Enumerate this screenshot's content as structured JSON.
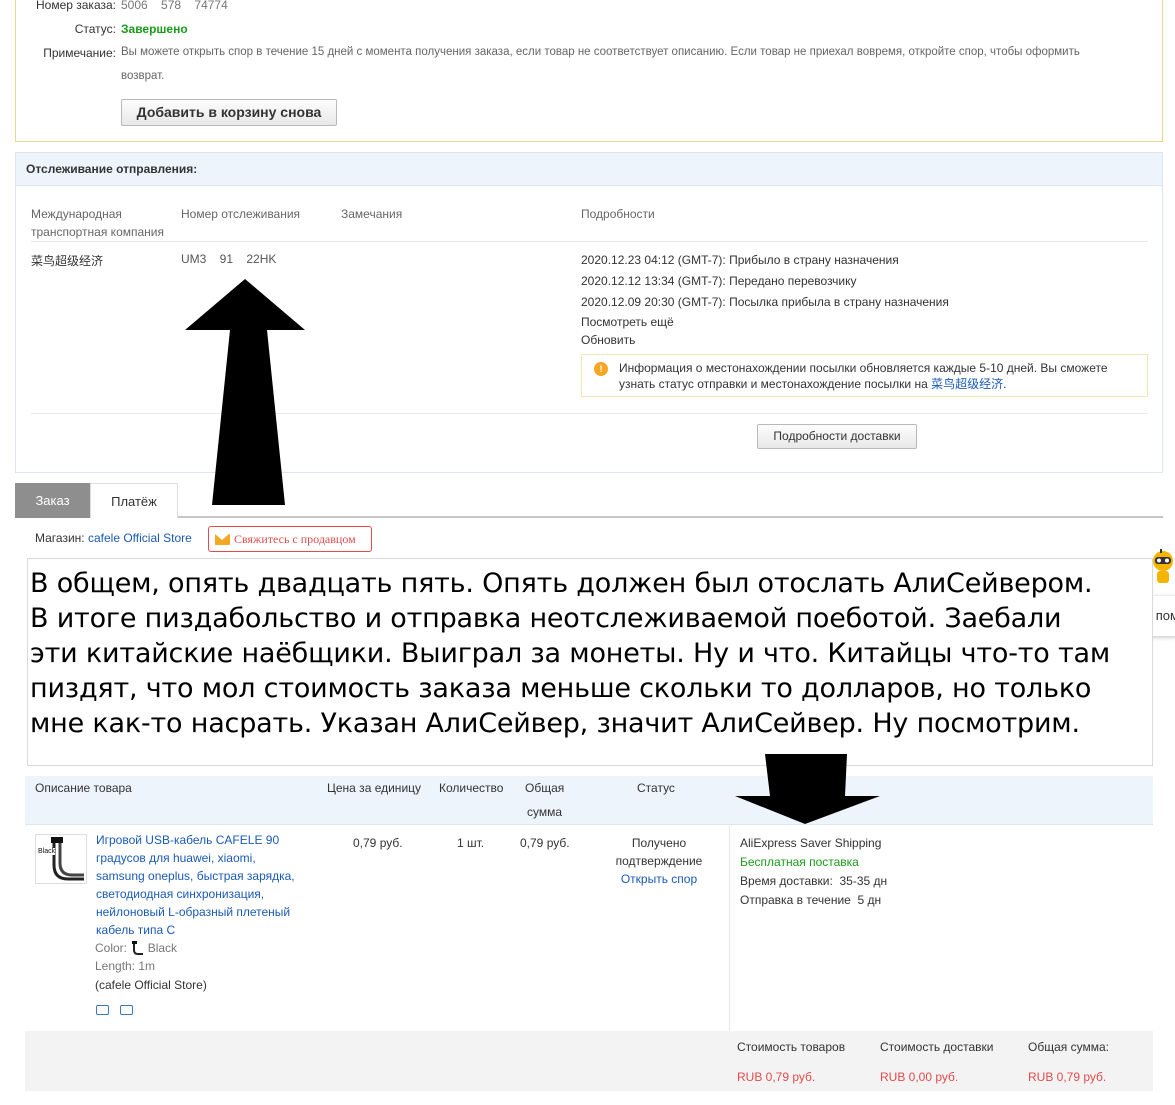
{
  "order": {
    "number_label": "Номер заказа:",
    "number_value": "5006    578    74774",
    "status_label": "Статус:",
    "status_value": "Завершено",
    "note_label": "Примечание:",
    "note_line1": "Вы можете открыть спор в течение 15 дней с момента получения заказа, если товар не соответствует описанию. Если товар не приехал вовремя, откройте спор, чтобы оформить",
    "note_line2": "возврат.",
    "readd_button": "Добавить в корзину снова"
  },
  "tracking": {
    "header": "Отслеживание отправления:",
    "columns": {
      "carrier": "Международная транспортная компания",
      "number": "Номер отслеживания",
      "remarks": "Замечания",
      "details": "Подробности"
    },
    "carrier": "菜鸟超级经济",
    "number": "UM3    91    22HK",
    "events": [
      "2020.12.23 04:12 (GMT-7): Прибыло в страну назначения",
      "2020.12.12 13:34 (GMT-7): Передано перевозчику",
      "2020.12.09 20:30 (GMT-7): Посылка прибыла в страну назначения"
    ],
    "see_more": "Посмотреть ещё",
    "refresh": "Обновить",
    "info_text_1": "Информация о местонахождении посылки обновляется каждые 5-10 дней. Вы сможете",
    "info_text_2": "узнать статус отправки и местонахождение посылки на",
    "info_link": "菜鸟超级经济",
    "info_end": ".",
    "details_button": "Подробности доставки"
  },
  "tabs": {
    "order": "Заказ",
    "payment": "Платёж"
  },
  "store": {
    "label": "Магазин:",
    "name": "cafele Official Store",
    "contact": "Свяжитесь с продавцом"
  },
  "caption": {
    "lines": [
      "В общем, опять двадцать пять. Опять должен был отослать АлиСейвером.",
      "В итоге пиздабольство и отправка неотслеживаемой поеботой. Заебали",
      "эти китайские наёбщики. Выиграл за монеты. Ну и что. Китайцы что-то там",
      "пиздят, что мол стоимость заказа меньше скольки то долларов, но только",
      "мне как-то насрать. Указан АлиСейвер, значит АлиСейвер. Ну посмотрим."
    ]
  },
  "help": {
    "bubble": "Нужна помощь?"
  },
  "table": {
    "headers": {
      "description": "Описание товара",
      "unit_price": "Цена за единицу",
      "quantity": "Количество",
      "total_line1": "Общая",
      "total_line2": "сумма",
      "status": "Статус"
    },
    "product": {
      "thumb_label": "Black",
      "title_lines": [
        "Игровой USB-кабель CAFELE 90",
        "градусов для huawei, xiaomi,",
        "samsung oneplus, быстрая зарядка,",
        "светодиодная синхронизация,",
        "нейлоновый L-образный плетеный",
        "кабель типа C"
      ],
      "color_label": "Color:",
      "color_value": "Black",
      "length": "Length: 1m",
      "store": "(cafele Official Store)",
      "price": "0,79 руб.",
      "quantity": "1 шт.",
      "total": "0,79 руб.",
      "status_line1": "Получено",
      "status_line2": "подтверждение",
      "dispute": "Открыть спор",
      "shipping_method": "AliExpress Saver Shipping",
      "free_shipping": "Бесплатная поставка",
      "delivery_time": "Время доставки:  35-35 дн",
      "dispatch_time": "Отправка в течение  5 дн"
    },
    "totals": {
      "goods_label": "Стоимость товаров",
      "shipping_label": "Стоимость доставки",
      "sum_label": "Общая сумма:",
      "goods_value": "RUB 0,79 руб.",
      "shipping_value": "RUB 0,00 руб.",
      "sum_value": "RUB 0,79 руб."
    }
  },
  "colors": {
    "link": "#1a5ab5",
    "status_green": "#1a9a1a",
    "price_red": "#e24c4c",
    "header_blue": "#eef4fb"
  }
}
